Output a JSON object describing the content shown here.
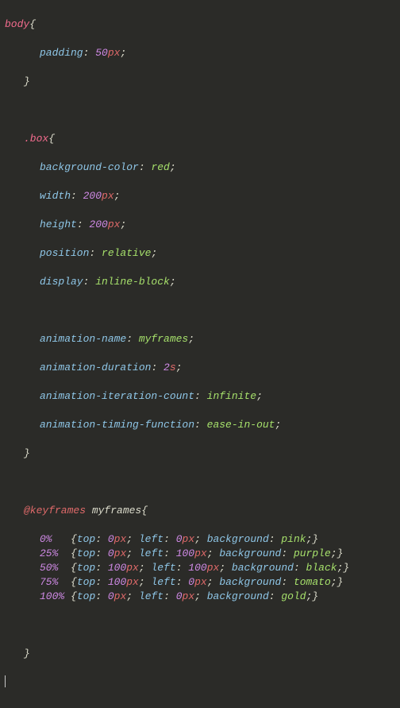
{
  "rules": {
    "body": {
      "selector": "body",
      "decls": [
        {
          "prop": "padding",
          "num": "50",
          "unit": "px"
        }
      ]
    },
    "box": {
      "selector": ".box",
      "decls": [
        {
          "prop": "background-color",
          "val": "red"
        },
        {
          "prop": "width",
          "num": "200",
          "unit": "px"
        },
        {
          "prop": "height",
          "num": "200",
          "unit": "px"
        },
        {
          "prop": "position",
          "val": "relative"
        },
        {
          "prop": "display",
          "val": "inline-block"
        },
        {
          "prop": "animation-name",
          "val": "myframes"
        },
        {
          "prop": "animation-duration",
          "num": "2",
          "unit": "s"
        },
        {
          "prop": "animation-iteration-count",
          "val": "infinite"
        },
        {
          "prop": "animation-timing-function",
          "val": "ease-in-out"
        }
      ]
    }
  },
  "keyframes": {
    "atrule": "@keyframes",
    "name": "myframes",
    "stops": [
      {
        "key": "0%",
        "pad": "  ",
        "top_num": "0",
        "top_unit": "px",
        "left_num": "0",
        "left_unit": "px",
        "bg": "pink"
      },
      {
        "key": "25%",
        "pad": " ",
        "top_num": "0",
        "top_unit": "px",
        "left_num": "100",
        "left_unit": "px",
        "bg": "purple"
      },
      {
        "key": "50%",
        "pad": " ",
        "top_num": "100",
        "top_unit": "px",
        "left_num": "100",
        "left_unit": "px",
        "bg": "black"
      },
      {
        "key": "75%",
        "pad": " ",
        "top_num": "100",
        "top_unit": "px",
        "left_num": "0",
        "left_unit": "px",
        "bg": "tomato"
      },
      {
        "key": "100%",
        "pad": "",
        "top_num": "0",
        "top_unit": "px",
        "left_num": "0",
        "left_unit": "px",
        "bg": "gold"
      }
    ]
  },
  "labels": {
    "top": "top",
    "left": "left",
    "background": "background"
  }
}
